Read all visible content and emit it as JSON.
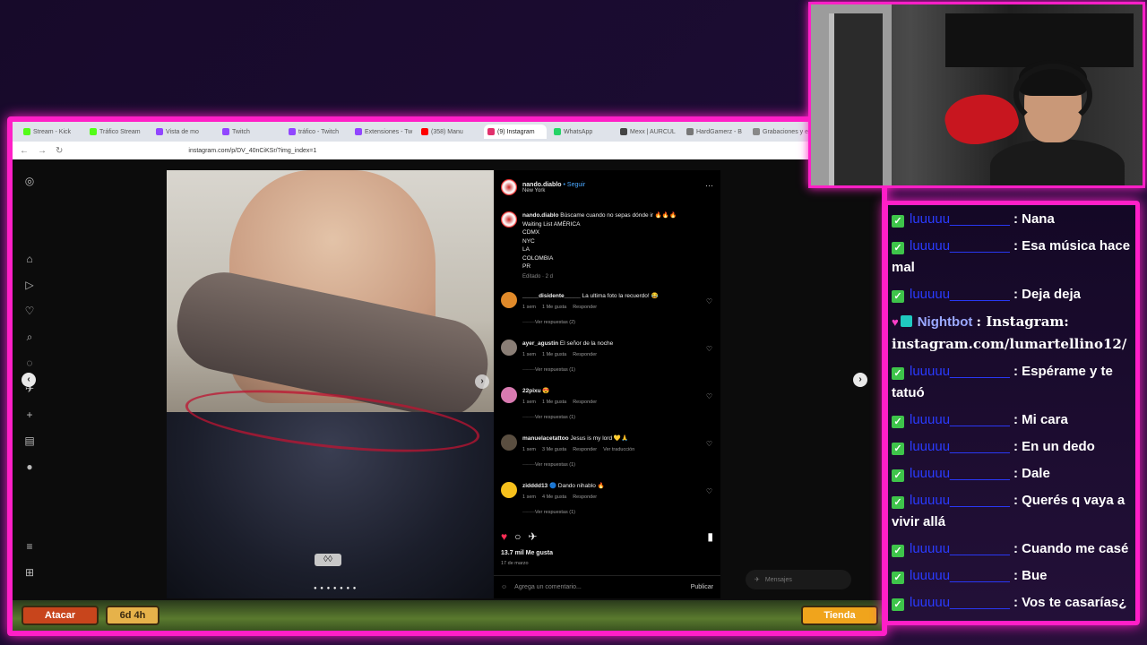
{
  "browser": {
    "tabs": [
      {
        "label": "Stream - Kick",
        "color": "#53fc18"
      },
      {
        "label": "Tráfico Stream",
        "color": "#53fc18"
      },
      {
        "label": "Vista de mo",
        "color": "#9146ff"
      },
      {
        "label": "Twitch",
        "color": "#9146ff"
      },
      {
        "label": "tráfico - Twitch",
        "color": "#9146ff"
      },
      {
        "label": "Extensiones - Tw",
        "color": "#9146ff"
      },
      {
        "label": "(358) Manu",
        "color": "#ff0000"
      },
      {
        "label": "(9) Instagram",
        "color": "#e1306c",
        "active": true
      },
      {
        "label": "WhatsApp",
        "color": "#25d366"
      },
      {
        "label": "Mexx | AURCUL",
        "color": "#444444"
      },
      {
        "label": "HardGamerz - B",
        "color": "#777777"
      },
      {
        "label": "Grabaciones y e",
        "color": "#888888"
      }
    ],
    "url": "instagram.com/p/DV_40nCiKSr/?img_index=1"
  },
  "post": {
    "username": "nando.diablo",
    "follow": "• Seguir",
    "location": "New York",
    "more_icon": "⋯",
    "caption_lines": [
      "Búscame cuando no sepas dónde ir 🔥🔥🔥",
      "Waiting List AMÉRICA",
      "CDMX",
      "NYC",
      "LA",
      "COLOMBIA",
      "PR"
    ],
    "edited": "Editado · 2 d",
    "car_logo": "◊◊",
    "dots": "● ● ● ● ● ● ●",
    "comments": [
      {
        "user": "_____disidente_____",
        "text": "La ultima foto la recuerdo! 😂",
        "time": "1 sem",
        "likes": "1 Me gusta",
        "reply": "Responder",
        "translate": "",
        "replies": "Ver respuestas (2)"
      },
      {
        "user": "ayer_agustin",
        "text": "El señor de la noche",
        "time": "1 sem",
        "likes": "1 Me gusta",
        "reply": "Responder",
        "translate": "",
        "replies": "Ver respuestas (1)"
      },
      {
        "user": "22pixu",
        "text": "😍",
        "time": "1 sem",
        "likes": "1 Me gusta",
        "reply": "Responder",
        "translate": "",
        "replies": "Ver respuestas (1)"
      },
      {
        "user": "manuelacetattoo",
        "text": "Jesus is my lord 💛🙏",
        "time": "1 sem",
        "likes": "3 Me gusta",
        "reply": "Responder",
        "translate": "Ver traducción",
        "replies": "Ver respuestas (1)"
      },
      {
        "user": "zidddd13",
        "text": "🔵 Dando nihablo 🔥",
        "time": "1 sem",
        "likes": "4 Me gusta",
        "reply": "Responder",
        "translate": "",
        "replies": "Ver respuestas (1)"
      }
    ],
    "likes_count": "13.7 mil Me gusta",
    "date": "17 de marzo",
    "add_comment_placeholder": "Agrega un comentario...",
    "publish": "Publicar",
    "messages": "Mensajes"
  },
  "game": {
    "buttons": [
      "Atacar",
      "6d 4h",
      "Tienda"
    ]
  },
  "chat": {
    "messages": [
      {
        "user": "luuuuu________",
        "text": ": Nana"
      },
      {
        "user": "luuuuu________",
        "text": ": Esa música hace mal"
      },
      {
        "user": "luuuuu________",
        "text": ": Deja deja"
      },
      {
        "user": "Nightbot",
        "text": ": Instagram: instagram.com/lumartellino12/",
        "bot": true
      },
      {
        "user": "luuuuu________",
        "text": ": Espérame y te tatuó"
      },
      {
        "user": "luuuuu________",
        "text": ": Mi cara"
      },
      {
        "user": "luuuuu________",
        "text": ": En un dedo"
      },
      {
        "user": "luuuuu________",
        "text": ": Dale"
      },
      {
        "user": "luuuuu________",
        "text": ": Querés q vaya a vivir allá"
      },
      {
        "user": "luuuuu________",
        "text": ": Cuando me casé"
      },
      {
        "user": "luuuuu________",
        "text": ": Bue"
      },
      {
        "user": "luuuuu________",
        "text": ": Vos te casarías¿"
      }
    ]
  },
  "colors": {
    "accent": "#ff1fc7",
    "like_red": "#ff2d55",
    "follow_blue": "#4aa8ff"
  }
}
